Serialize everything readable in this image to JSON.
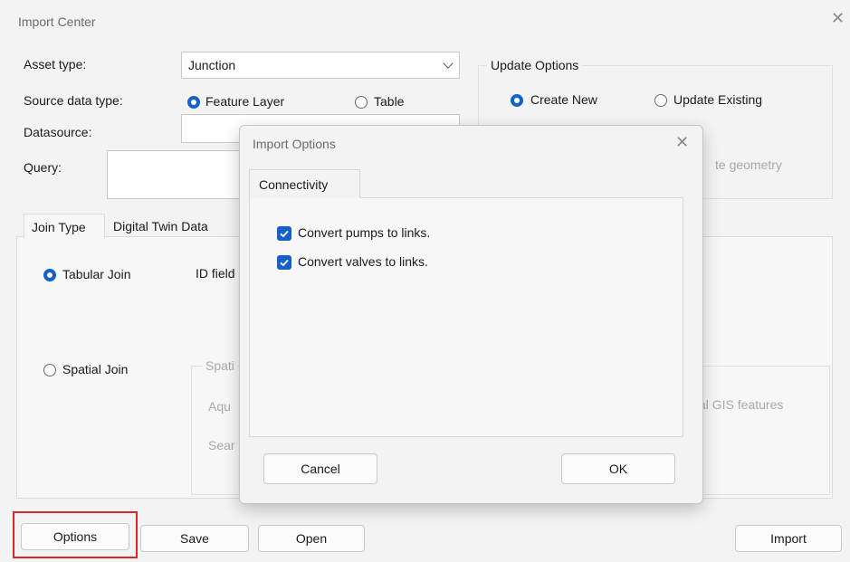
{
  "window": {
    "title": "Import Center",
    "close_glyph": "✕"
  },
  "form": {
    "asset_type_label": "Asset type:",
    "asset_type_value": "Junction",
    "source_type_label": "Source data type:",
    "source_feature_layer": "Feature Layer",
    "source_table": "Table",
    "datasource_label": "Datasource:",
    "query_label": "Query:"
  },
  "update_options": {
    "title": "Update Options",
    "create_new": "Create New",
    "update_existing": "Update Existing",
    "partial_text": "te geometry"
  },
  "tabs": {
    "join_type": "Join Type",
    "digital_twin": "Digital Twin Data"
  },
  "join": {
    "tabular": "Tabular Join",
    "id_field": "ID field",
    "spatial": "Spatial Join",
    "spatial_group": "Spati",
    "aqu": "Aqu",
    "sear": "Sear",
    "gis_features": "al GIS features"
  },
  "buttons": {
    "options": "Options",
    "save": "Save",
    "open": "Open",
    "import": "Import"
  },
  "modal": {
    "title": "Import Options",
    "close_glyph": "✕",
    "tab": "Connectivity",
    "check_pumps": "Convert pumps to links.",
    "check_valves": "Convert valves to links.",
    "cancel": "Cancel",
    "ok": "OK"
  },
  "colors": {
    "accent": "#1462c8",
    "highlight": "#d9262b"
  }
}
